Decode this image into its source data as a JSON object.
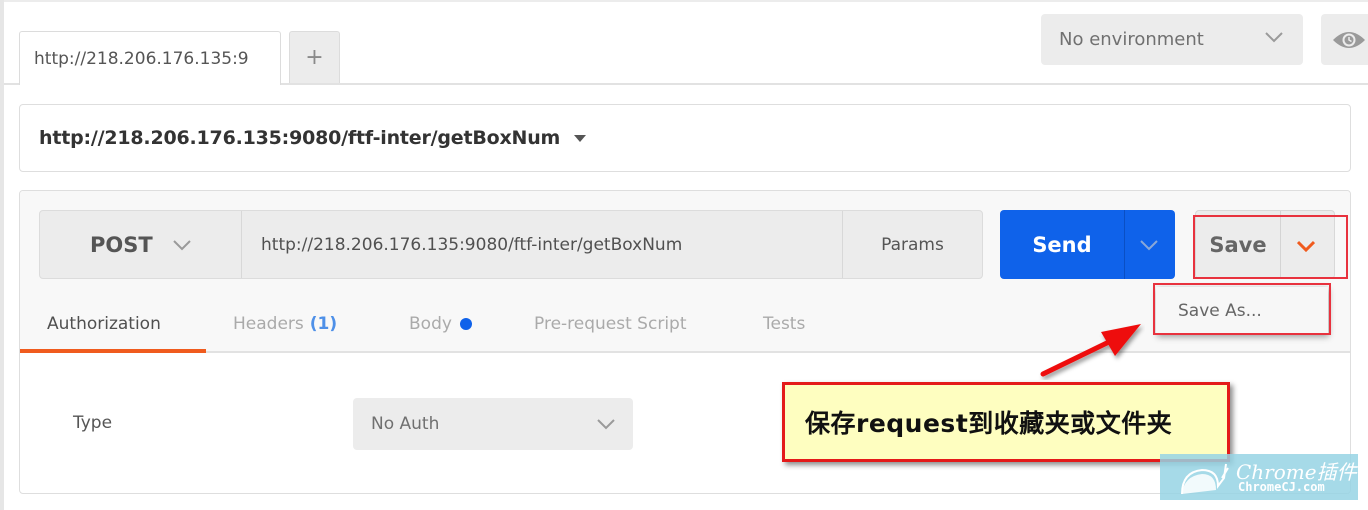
{
  "tabbar": {
    "active_tab_label": "http://218.206.176.135:9",
    "add_tab_label": "+",
    "environment_selected": "No environment",
    "eye_icon": "eye-icon"
  },
  "request": {
    "title": "http://218.206.176.135:9080/ftf-inter/getBoxNum",
    "method": "POST",
    "url": "http://218.206.176.135:9080/ftf-inter/getBoxNum",
    "params_label": "Params",
    "send_label": "Send",
    "save_label": "Save",
    "save_as_label": "Save As..."
  },
  "request_tabs": [
    {
      "label": "Authorization",
      "active": true
    },
    {
      "label": "Headers",
      "count": "(1)"
    },
    {
      "label": "Body",
      "indicator": "dot"
    },
    {
      "label": "Pre-request Script"
    },
    {
      "label": "Tests"
    }
  ],
  "auth": {
    "type_label": "Type",
    "type_value": "No Auth"
  },
  "annotation": {
    "callout_text": "保存request到收藏夹或文件夹"
  },
  "watermark": {
    "brand": "Chrome插件",
    "domain": "ChromeCJ.com"
  },
  "colors": {
    "send_blue": "#0f62ea",
    "active_tab_orange": "#f05b1e",
    "save_chevron_orange": "#f05b1e",
    "annotation_red": "#e41a1a",
    "callout_bg": "#fefec0",
    "headers_count_blue": "#4e90e8"
  }
}
